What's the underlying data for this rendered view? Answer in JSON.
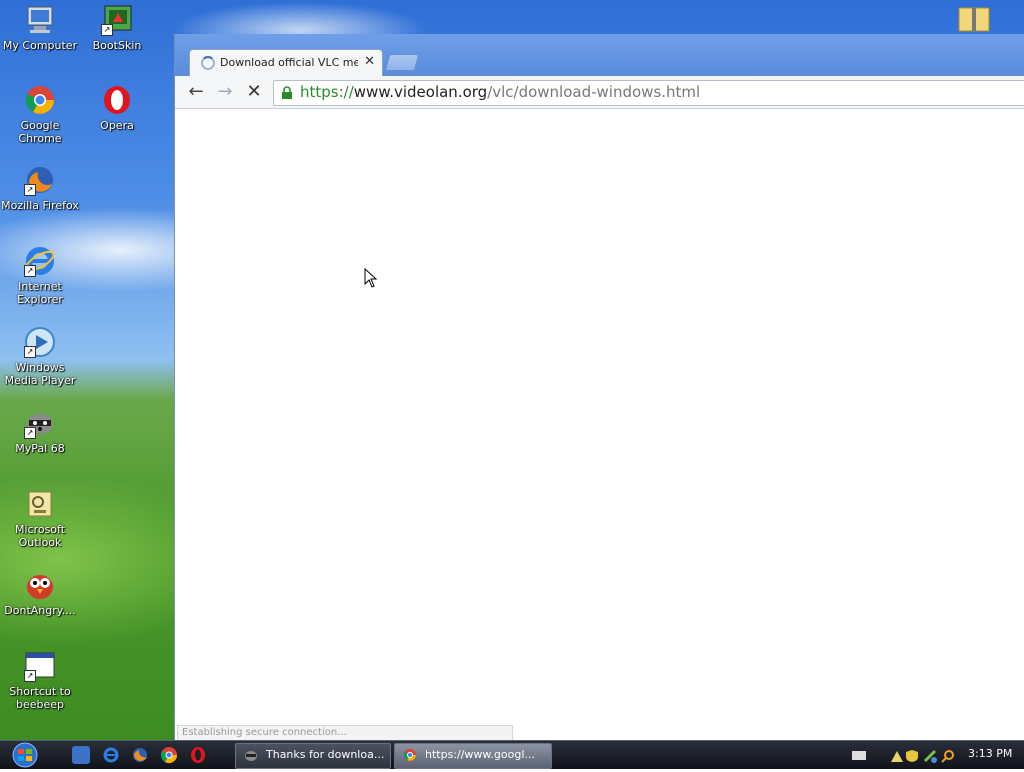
{
  "desktop": {
    "icons": [
      {
        "label": "My Computer"
      },
      {
        "label": "BootSkin"
      },
      {
        "label": "Google Chrome"
      },
      {
        "label": "Opera"
      },
      {
        "label": "Mozilla Firefox"
      },
      {
        "label": "Internet Explorer"
      },
      {
        "label": "Windows Media Player"
      },
      {
        "label": "MyPal 68"
      },
      {
        "label": "Microsoft Outlook"
      },
      {
        "label": "DontAngry...."
      },
      {
        "label": "Shortcut to beebeep"
      }
    ]
  },
  "browser": {
    "tab_title": "Download official VLC media player for Windows",
    "url_scheme": "https://",
    "url_host": "www.videolan.org",
    "url_path": "/vlc/download-windows.html",
    "status_text": "Establishing secure connection..."
  },
  "taskbar": {
    "tasks": [
      {
        "label": "Thanks for downloa..."
      },
      {
        "label": "https://www.googl..."
      }
    ],
    "clock": "3:13 PM"
  },
  "colors": {
    "url_scheme_green": "#2a8a2a",
    "titlebar_blue": "#5a8cdc",
    "taskbar_dark": "#1a1e27"
  }
}
